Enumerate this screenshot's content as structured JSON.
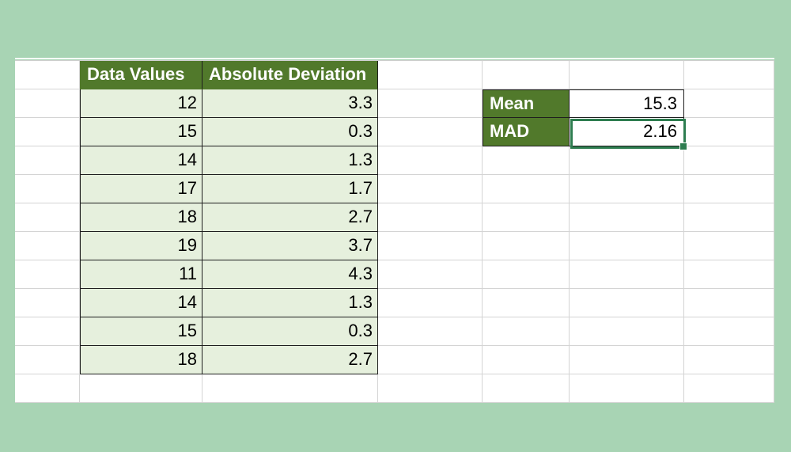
{
  "table": {
    "headers": [
      "Data Values",
      "Absolute Deviation"
    ],
    "rows": [
      {
        "value": "12",
        "absdev": "3.3"
      },
      {
        "value": "15",
        "absdev": "0.3"
      },
      {
        "value": "14",
        "absdev": "1.3"
      },
      {
        "value": "17",
        "absdev": "1.7"
      },
      {
        "value": "18",
        "absdev": "2.7"
      },
      {
        "value": "19",
        "absdev": "3.7"
      },
      {
        "value": "11",
        "absdev": "4.3"
      },
      {
        "value": "14",
        "absdev": "1.3"
      },
      {
        "value": "15",
        "absdev": "0.3"
      },
      {
        "value": "18",
        "absdev": "2.7"
      }
    ]
  },
  "summary": {
    "mean_label": "Mean",
    "mean_value": "15.3",
    "mad_label": "MAD",
    "mad_value": "2.16"
  }
}
